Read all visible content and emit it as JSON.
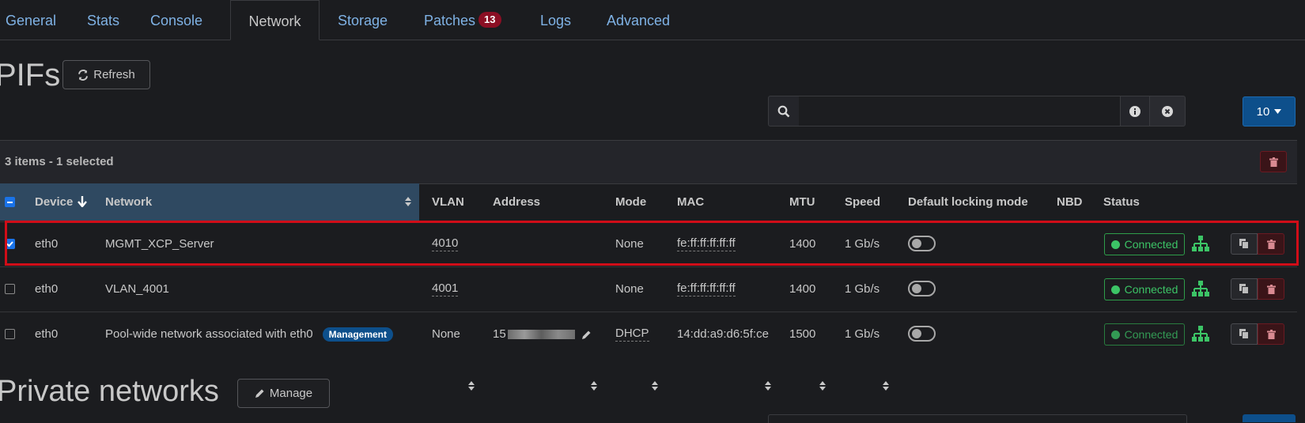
{
  "tabs": [
    {
      "label": "General"
    },
    {
      "label": "Stats"
    },
    {
      "label": "Console"
    },
    {
      "label": "Network"
    },
    {
      "label": "Storage"
    },
    {
      "label": "Patches",
      "badge": "13"
    },
    {
      "label": "Logs"
    },
    {
      "label": "Advanced"
    }
  ],
  "active_tab": "Network",
  "pifs": {
    "title": "PIFs",
    "refresh_label": "Refresh",
    "search": {
      "value": "",
      "placeholder": ""
    },
    "page_size": "10",
    "selection_summary": "3 items - 1 selected",
    "columns": [
      "Device",
      "Network",
      "VLAN",
      "Address",
      "Mode",
      "MAC",
      "MTU",
      "Speed",
      "Default locking mode",
      "NBD",
      "Status"
    ],
    "sorted_column": "Device",
    "rows": [
      {
        "selected": true,
        "device": "eth0",
        "network": "MGMT_XCP_Server",
        "badge": "",
        "vlan": "4010",
        "address": "",
        "mode": "None",
        "mac": "fe:ff:ff:ff:ff:ff",
        "mtu": "1400",
        "speed": "1 Gb/s",
        "locking_on": false,
        "status": "Connected"
      },
      {
        "selected": false,
        "device": "eth0",
        "network": "VLAN_4001",
        "badge": "",
        "vlan": "4001",
        "address": "",
        "mode": "None",
        "mac": "fe:ff:ff:ff:ff:ff",
        "mtu": "1400",
        "speed": "1 Gb/s",
        "locking_on": false,
        "status": "Connected"
      },
      {
        "selected": false,
        "device": "eth0",
        "network": "Pool-wide network associated with eth0",
        "badge": "Management",
        "vlan": "None",
        "address": "15",
        "mode": "DHCP",
        "mac": "14:dd:a9:d6:5f:ce",
        "mtu": "1500",
        "speed": "1 Gb/s",
        "locking_on": false,
        "status": "Connected"
      }
    ]
  },
  "private_networks": {
    "title": "Private networks",
    "manage_label": "Manage"
  },
  "colors": {
    "accent": "#0d4f8b",
    "link": "#7fb2e5",
    "success": "#3cc466",
    "danger": "#8b0f24",
    "highlight": "#d00d18"
  },
  "icons": [
    "refresh-icon",
    "search-icon",
    "info-icon",
    "clear-icon",
    "caret-down-icon",
    "trash-icon",
    "copy-icon",
    "network-icon",
    "pencil-icon",
    "sort-icon"
  ]
}
